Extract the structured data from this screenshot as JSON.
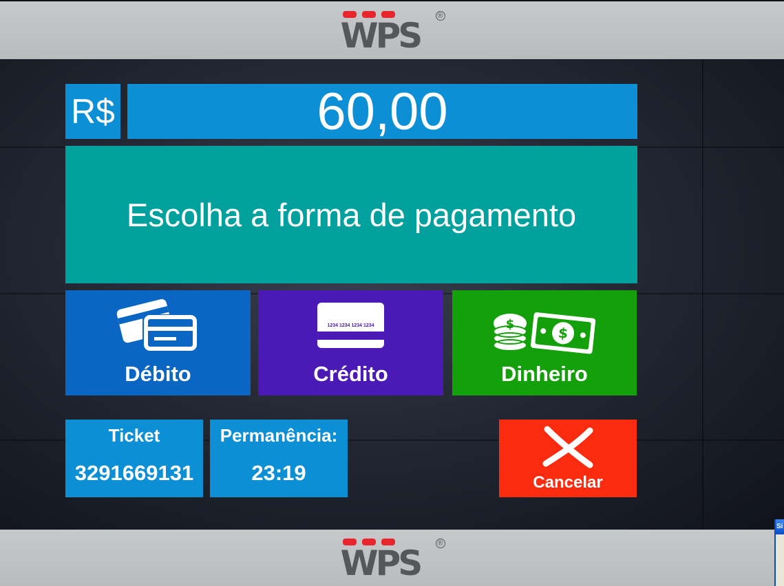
{
  "header": {
    "logo_text": "WPS",
    "logo_mark": "®"
  },
  "footer": {
    "logo_text": "WPS",
    "logo_mark": "®"
  },
  "amount": {
    "currency": "R$",
    "value": "60,00"
  },
  "prompt": "Escolha a forma de pagamento",
  "payment_methods": [
    {
      "label": "Débito",
      "icon": "debit-cards-icon",
      "color": "#0a66c2"
    },
    {
      "label": "Crédito",
      "icon": "credit-card-icon",
      "color": "#4a19b6",
      "card_number": "1234 1234 1234 1234"
    },
    {
      "label": "Dinheiro",
      "icon": "cash-icon",
      "color": "#14a00a"
    }
  ],
  "ticket": {
    "title": "Ticket",
    "value": "3291669131"
  },
  "stay": {
    "title": "Permanência:",
    "value": "23:19"
  },
  "cancel": {
    "label": "Cancelar",
    "icon": "close-x-icon",
    "color": "#fb2b10"
  },
  "side_window": {
    "caption": "Si"
  },
  "colors": {
    "accent_blue": "#0d8fd6",
    "teal": "#02a19d",
    "logo_red": "#e8252c",
    "logo_gray": "#55575b"
  }
}
